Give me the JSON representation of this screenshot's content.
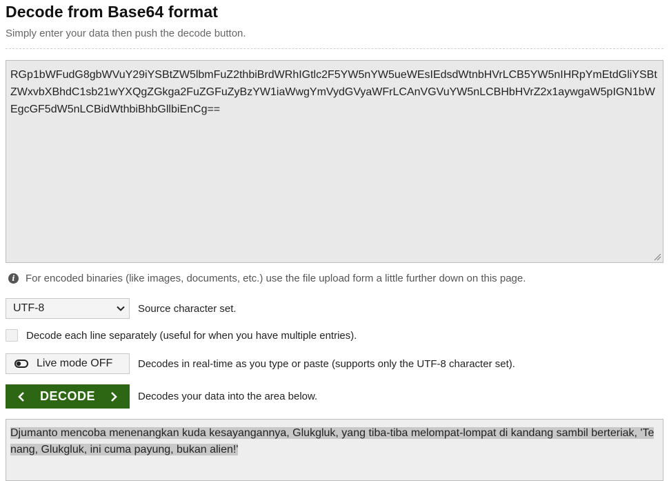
{
  "page": {
    "title": "Decode from Base64 format",
    "subtitle": "Simply enter your data then push the decode button."
  },
  "input": {
    "value": "RGp1bWFudG8gbWVuY29iYSBtZW5lbmFuZ2thbiBrdWRhIGtlc2F5YW5nYW5ueWEsIEdsdWtnbHVrLCB5YW5nIHRpYmEtdGliYSBtZWxvbXBhdC1sb21wYXQgZGkga2FuZGFuZyBzYW1iaWwgYmVydGVyaWFrLCAnVGVuYW5nLCBHbHVrZ2x1aywgaW5pIGN1bWEgcGF5dW5nLCBidWthbiBhbGllbiEnCg=="
  },
  "note": {
    "text": "For encoded binaries (like images, documents, etc.) use the file upload form a little further down on this page."
  },
  "charset": {
    "selected": "UTF-8",
    "label": "Source character set."
  },
  "line_option": {
    "label": "Decode each line separately (useful for when you have multiple entries)."
  },
  "live_mode": {
    "button_label": "Live mode OFF",
    "description": "Decodes in real-time as you type or paste (supports only the UTF-8 character set)."
  },
  "decode": {
    "button_label": "DECODE",
    "description": "Decodes your data into the area below."
  },
  "output": {
    "value": "Djumanto mencoba menenangkan kuda kesayangannya, Glukgluk, yang tiba-tiba melompat-lompat di kandang sambil berteriak, 'Tenang, Glukgluk, ini cuma payung, bukan alien!'"
  },
  "colors": {
    "decode_button": "#2e6713",
    "input_background": "#e9e9e9",
    "output_selection": "#c8c8c8"
  },
  "icons": [
    "info-icon",
    "chevron-down-icon",
    "toggle-off-icon",
    "chevron-left-icon",
    "chevron-right-icon"
  ]
}
